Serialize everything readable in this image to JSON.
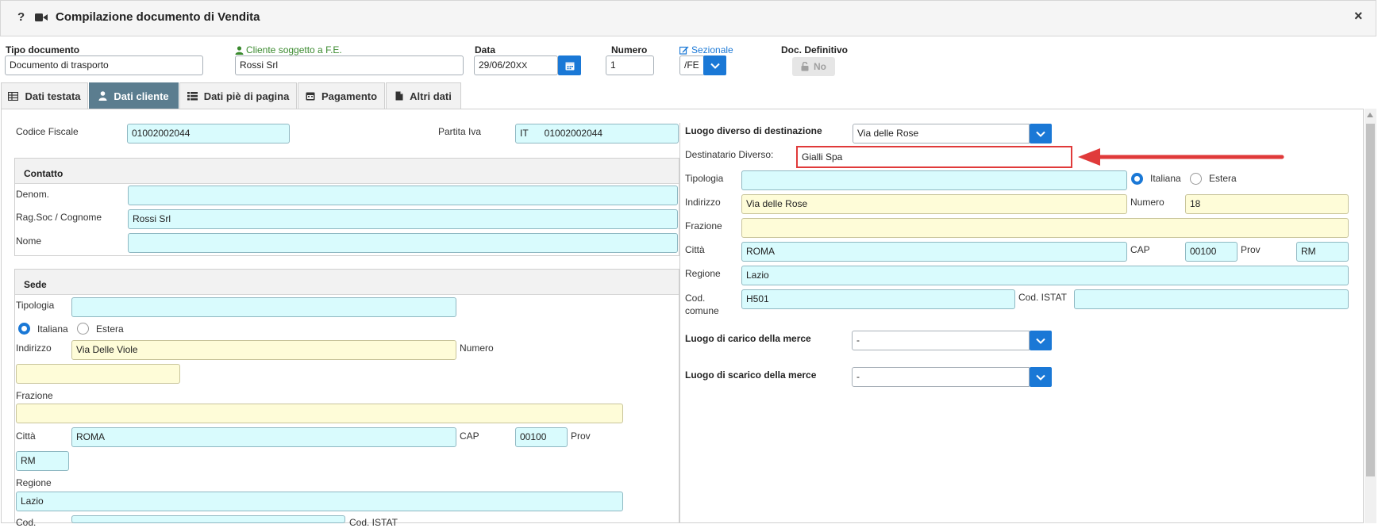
{
  "window": {
    "title": "Compilazione documento di Vendita",
    "help_glyph": "?",
    "camera_icon": "video-camera-icon",
    "close_glyph": "×"
  },
  "header": {
    "tipo_documento": {
      "label": "Tipo documento",
      "value": "Documento di trasporto"
    },
    "cliente": {
      "label": "Cliente soggetto a F.E.",
      "value": "Rossi Srl",
      "color": "#3a8a2e"
    },
    "data": {
      "label": "Data",
      "value": "29/06/20",
      "suffix": "XX"
    },
    "numero": {
      "label": "Numero",
      "value": "1"
    },
    "sezionale": {
      "label": "Sezionale",
      "value": "/FE",
      "color": "#1a78d6"
    },
    "doc_definitivo": {
      "label": "Doc. Definitivo",
      "button": "No"
    }
  },
  "tabs": [
    {
      "label": "Dati testata",
      "icon": "table-icon",
      "active": false
    },
    {
      "label": "Dati cliente",
      "icon": "user-icon",
      "active": true
    },
    {
      "label": "Dati piè di pagina",
      "icon": "list-icon",
      "active": false
    },
    {
      "label": "Pagamento",
      "icon": "calendar-icon",
      "active": false
    },
    {
      "label": "Altri dati",
      "icon": "file-icon",
      "active": false
    }
  ],
  "left": {
    "codice_fiscale": {
      "label": "Codice Fiscale",
      "value": "01002002044"
    },
    "partita_iva": {
      "label": "Partita Iva",
      "prefix": "IT",
      "value": "01002002044"
    },
    "contatto": {
      "title": "Contatto",
      "denom": {
        "label": "Denom.",
        "value": ""
      },
      "ragsoc": {
        "label": "Rag.Soc / Cognome",
        "value": "Rossi Srl"
      },
      "nome": {
        "label": "Nome",
        "value": ""
      }
    },
    "sede": {
      "title": "Sede",
      "tipologia": {
        "label": "Tipologia",
        "value": ""
      },
      "radio_italiana": "Italiana",
      "radio_estera": "Estera",
      "indirizzo": {
        "label": "Indirizzo",
        "value": "Via Delle Viole"
      },
      "numero": {
        "label": "Numero",
        "value": ""
      },
      "frazione": {
        "label": "Frazione",
        "value": ""
      },
      "citta": {
        "label": "Città",
        "value": "ROMA"
      },
      "cap": {
        "label": "CAP",
        "value": "00100"
      },
      "prov": {
        "label": "Prov",
        "value": "RM"
      },
      "regione": {
        "label": "Regione",
        "value": "Lazio"
      },
      "cod_comune": {
        "label": "Cod.",
        "value": ""
      },
      "cod_istat": {
        "label": "Cod. ISTAT",
        "value": ""
      }
    }
  },
  "right": {
    "luogo_destinazione": {
      "label": "Luogo diverso di destinazione",
      "value": "Via delle Rose"
    },
    "destinatario": {
      "label": "Destinatario Diverso:",
      "value": "Gialli Spa"
    },
    "tipologia": {
      "label": "Tipologia",
      "value": ""
    },
    "radio_italiana": "Italiana",
    "radio_estera": "Estera",
    "indirizzo": {
      "label": "Indirizzo",
      "value": "Via delle Rose"
    },
    "numero": {
      "label": "Numero",
      "value": "18"
    },
    "frazione": {
      "label": "Frazione",
      "value": ""
    },
    "citta": {
      "label": "Città",
      "value": "ROMA"
    },
    "cap": {
      "label": "CAP",
      "value": "00100"
    },
    "prov": {
      "label": "Prov",
      "value": "RM"
    },
    "regione": {
      "label": "Regione",
      "value": "Lazio"
    },
    "cod_comune": {
      "label1": "Cod.",
      "label2": "comune",
      "value": "H501"
    },
    "cod_istat": {
      "label": "Cod. ISTAT",
      "value": ""
    },
    "luogo_carico": {
      "label": "Luogo di carico della merce",
      "value": "-"
    },
    "luogo_scarico": {
      "label": "Luogo di scarico della merce",
      "value": "-"
    }
  },
  "colors": {
    "accent": "#1a78d6",
    "cyan_field": "#d9fbfd",
    "yellow_field": "#fefcd8",
    "highlight": "#e03a3a",
    "active_tab": "#5b7d8f"
  }
}
